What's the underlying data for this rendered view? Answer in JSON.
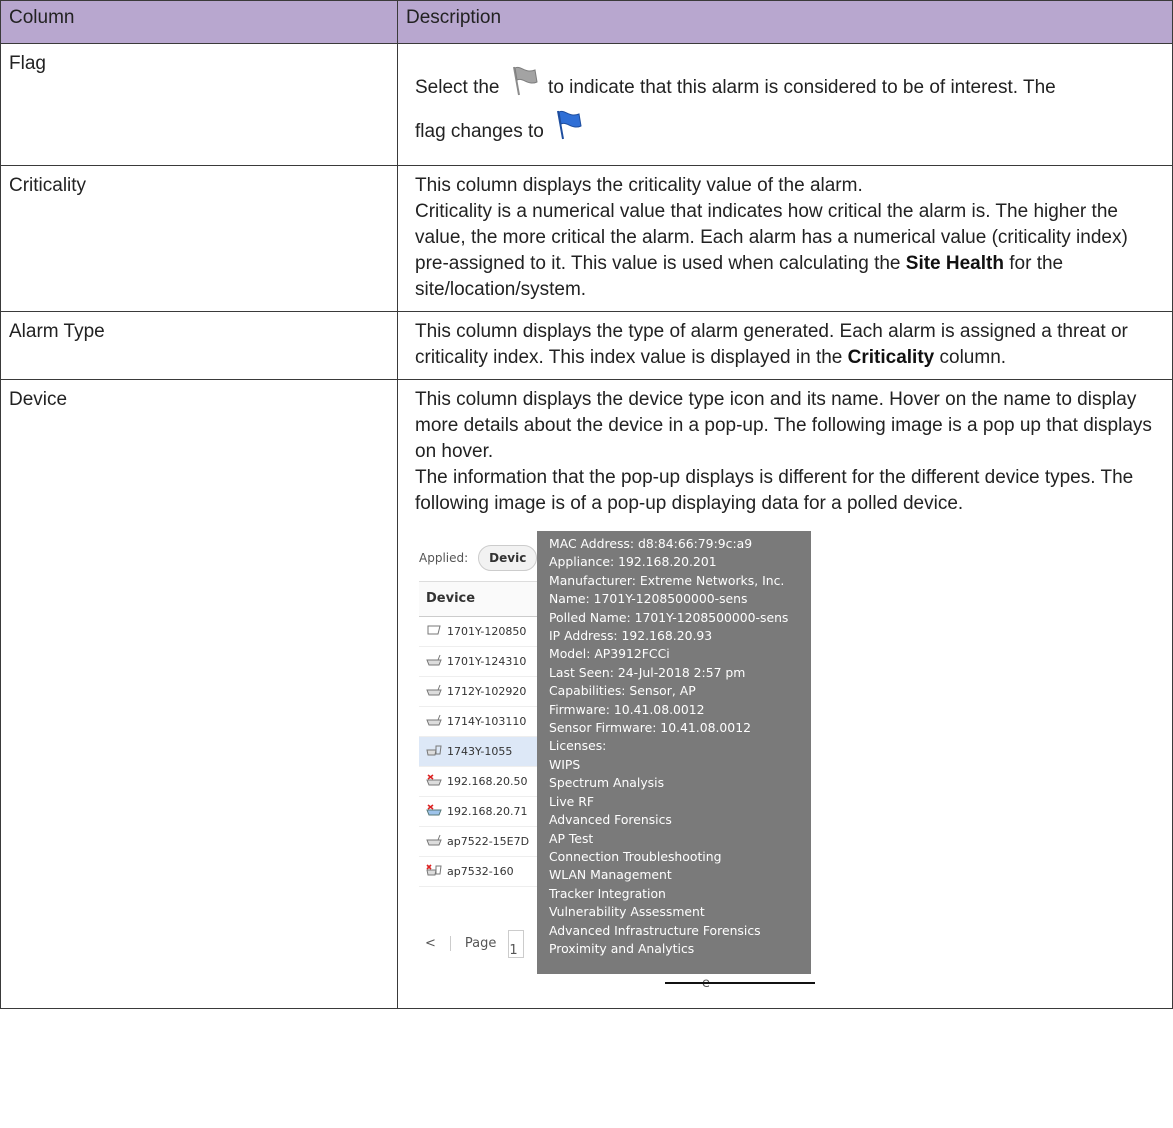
{
  "table": {
    "headers": [
      "Column",
      "Description"
    ],
    "flag_row": {
      "column": "Flag",
      "before_icon": "Select the ",
      "after_icon": " to indicate that this alarm is considered to be of interest. The",
      "line2": "flag changes to "
    },
    "criticality_row": {
      "column": "Criticality",
      "line1": "This column displays the criticality value of the alarm.",
      "para2_a": "Criticality is a numerical value that indicates how critical the alarm is. The higher the value, the more critical the alarm. Each alarm has a numerical value (criticality index) pre-assigned to it. This value is used when calculating the ",
      "para2_bold": "Site Health",
      "para2_b": " for the site/location/system."
    },
    "alarm_row": {
      "column": "Alarm Type",
      "text_a": "This column displays the type of alarm generated. Each alarm is assigned a threat or criticality index. This index value is displayed in the ",
      "text_bold": "Criticality",
      "text_b": " column."
    },
    "device_row": {
      "column": "Device",
      "para1": "This column displays the device type icon and its name. Hover on the name to display more details about the device in a pop-up. The following image is a pop up that displays on hover.",
      "para2": "The information that the pop-up displays is different for the different device types. The following image is of a pop-up displaying data for a polled device."
    }
  },
  "icons": {
    "flag_unselected": "gray-flag-icon",
    "flag_selected": "blue-flag-icon"
  },
  "colors": {
    "header_bg": "#b8a7cf",
    "tooltip_bg": "#7a7a7a",
    "flag_gray": "#9a9a9a",
    "flag_blue": "#2f6fd6"
  },
  "screenshot": {
    "applied_label": "Applied:",
    "filter_chip": "Devic",
    "column_header": "Device",
    "devices": [
      "1701Y-120850",
      "1701Y-124310",
      "1712Y-102920",
      "1714Y-103110",
      "1743Y-1055",
      "192.168.20.50",
      "192.168.20.71",
      "ap7522-15E7D",
      "ap7532-160"
    ],
    "pager_label": "Page",
    "pager_input": "1",
    "pager_trailing": "e",
    "tooltip_lines": [
      "MAC Address: d8:84:66:79:9c:a9",
      "Appliance: 192.168.20.201",
      "Manufacturer: Extreme Networks, Inc.",
      "Name: 1701Y-1208500000-sens",
      "Polled Name: 1701Y-1208500000-sens",
      "IP Address: 192.168.20.93",
      "Model: AP3912FCCi",
      "Last Seen: 24-Jul-2018 2:57 pm",
      "Capabilities: Sensor, AP",
      "Firmware: 10.41.08.0012",
      "Sensor Firmware: 10.41.08.0012",
      "Licenses:",
      "WIPS",
      "Spectrum Analysis",
      "Live RF",
      "Advanced Forensics",
      "AP Test",
      "Connection Troubleshooting",
      "WLAN Management",
      "Tracker Integration",
      "Vulnerability Assessment",
      "Advanced Infrastructure Forensics",
      "Proximity and Analytics"
    ]
  }
}
